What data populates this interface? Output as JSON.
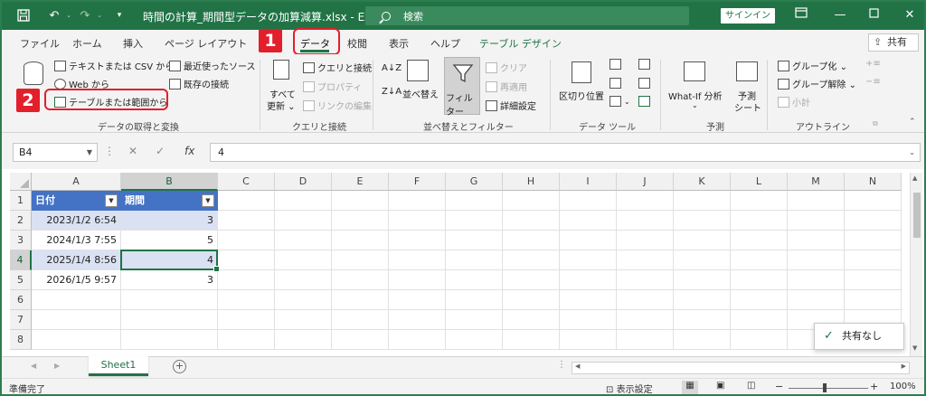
{
  "app": {
    "title": "時間の計算_期間型データの加算減算.xlsx  -  Excel",
    "search_label": "検索",
    "signin_label": "サインイン",
    "share_label": "共有",
    "window_buttons": [
      "minimize-icon",
      "maximize-icon",
      "close-icon"
    ]
  },
  "quick_access": [
    "save-icon",
    "undo-icon",
    "redo-icon",
    "customize-icon"
  ],
  "tabs": [
    "ファイル",
    "ホーム",
    "挿入",
    "ページ レイアウト",
    "データ",
    "校閲",
    "表示",
    "ヘルプ",
    "テーブル デザイン"
  ],
  "active_tab": "データ",
  "ribbon": {
    "get_data": {
      "items": [
        "テキストまたは CSV から",
        "Web から",
        "テーブルまたは範囲から",
        "最近使ったソース",
        "既存の接続"
      ],
      "label": "データの取得と変換"
    },
    "queries": {
      "refresh_label_1": "すべて",
      "refresh_label_2": "更新 ⌄",
      "items": [
        "クエリと接続",
        "プロパティ",
        "リンクの編集"
      ],
      "label": "クエリと接続"
    },
    "sort_filter": {
      "sort_label": "並べ替え",
      "filter_label": "フィルター",
      "items": [
        "クリア",
        "再適用",
        "詳細設定"
      ],
      "label": "並べ替えとフィルター"
    },
    "data_tools": {
      "split_label": "区切り位置",
      "label": "データ ツール"
    },
    "forecast": {
      "whatif_label": "What-If 分析",
      "sheet_label_1": "予測",
      "sheet_label_2": "シート",
      "label": "予測"
    },
    "outline": {
      "items": [
        "グループ化 ⌄",
        "グループ解除 ⌄",
        "小計"
      ],
      "label": "アウトライン"
    }
  },
  "callouts": [
    "1",
    "2"
  ],
  "formula_bar": {
    "name_box": "B4",
    "formula": "4"
  },
  "columns": [
    "A",
    "B",
    "C",
    "D",
    "E",
    "F",
    "G",
    "H",
    "I",
    "J",
    "K",
    "L",
    "M",
    "N"
  ],
  "rows": [
    "1",
    "2",
    "3",
    "4",
    "5",
    "6",
    "7",
    "8"
  ],
  "table": {
    "headers": [
      "日付",
      "期間"
    ],
    "rows": [
      [
        "2023/1/2 6:54",
        "3"
      ],
      [
        "2024/1/3 7:55",
        "5"
      ],
      [
        "2025/1/4 8:56",
        "4"
      ],
      [
        "2026/1/5 9:57",
        "3"
      ]
    ]
  },
  "selected_cell": "B4",
  "toast": "共有なし",
  "sheet_tabs": [
    "Sheet1"
  ],
  "status": {
    "ready": "準備完了",
    "display_settings": "表示設定",
    "zoom": "100%"
  }
}
